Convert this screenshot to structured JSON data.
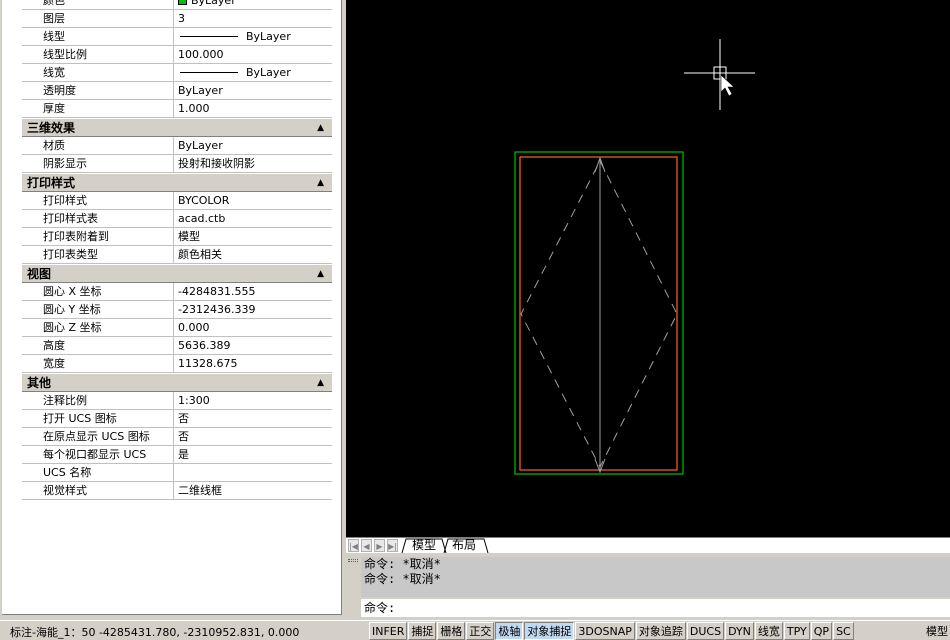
{
  "palette": {
    "rows_top": [
      {
        "name": "颜色",
        "value": "ByLayer",
        "kind": "color"
      },
      {
        "name": "图层",
        "value": "3",
        "kind": "text"
      },
      {
        "name": "线型",
        "value": "ByLayer",
        "kind": "line"
      },
      {
        "name": "线型比例",
        "value": "100.000",
        "kind": "text"
      },
      {
        "name": "线宽",
        "value": "ByLayer",
        "kind": "line"
      },
      {
        "name": "透明度",
        "value": "ByLayer",
        "kind": "text"
      },
      {
        "name": "厚度",
        "value": "1.000",
        "kind": "text"
      }
    ],
    "sections": [
      {
        "title": "三维效果",
        "rows": [
          {
            "name": "材质",
            "value": "ByLayer"
          },
          {
            "name": "阴影显示",
            "value": "投射和接收阴影"
          }
        ]
      },
      {
        "title": "打印样式",
        "rows": [
          {
            "name": "打印样式",
            "value": "BYCOLOR"
          },
          {
            "name": "打印样式表",
            "value": "acad.ctb"
          },
          {
            "name": "打印表附着到",
            "value": "模型"
          },
          {
            "name": "打印表类型",
            "value": "颜色相关"
          }
        ]
      },
      {
        "title": "视图",
        "rows": [
          {
            "name": "圆心 X 坐标",
            "value": "-4284831.555"
          },
          {
            "name": "圆心 Y 坐标",
            "value": "-2312436.339"
          },
          {
            "name": "圆心 Z 坐标",
            "value": "0.000"
          },
          {
            "name": "高度",
            "value": "5636.389"
          },
          {
            "name": "宽度",
            "value": "11328.675"
          }
        ]
      },
      {
        "title": "其他",
        "rows": [
          {
            "name": "注释比例",
            "value": "1:300"
          },
          {
            "name": "打开 UCS 图标",
            "value": "否"
          },
          {
            "name": "在原点显示 UCS 图标",
            "value": "否"
          },
          {
            "name": "每个视口都显示 UCS",
            "value": "是"
          },
          {
            "name": "UCS 名称",
            "value": ""
          },
          {
            "name": "视觉样式",
            "value": "二维线框"
          }
        ]
      }
    ]
  },
  "tabs": {
    "model": "模型",
    "layout": "布局"
  },
  "command": {
    "history": [
      "命令: *取消*",
      "命令: *取消*"
    ],
    "prompt": "命令:"
  },
  "status": {
    "coords": "标注-海能_1：50   -4285431.780, -2310952.831, 0.000",
    "toggles": [
      {
        "label": "INFER",
        "on": false
      },
      {
        "label": "捕捉",
        "on": false
      },
      {
        "label": "栅格",
        "on": false
      },
      {
        "label": "正交",
        "on": false
      },
      {
        "label": "极轴",
        "on": true
      },
      {
        "label": "对象捕捉",
        "on": true
      },
      {
        "label": "3DOSNAP",
        "on": false
      },
      {
        "label": "对象追踪",
        "on": false
      },
      {
        "label": "DUCS",
        "on": false
      },
      {
        "label": "DYN",
        "on": false
      },
      {
        "label": "线宽",
        "on": false
      },
      {
        "label": "TPY",
        "on": false
      },
      {
        "label": "QP",
        "on": false
      },
      {
        "label": "SC",
        "on": false
      }
    ],
    "space": "模型"
  },
  "colors": {
    "outer_rect": "#00c000",
    "inner_rect": "#ff6030",
    "diamond": "#a0a0a0",
    "axis": "#a0a0a0",
    "crosshair": "#ffffff"
  }
}
